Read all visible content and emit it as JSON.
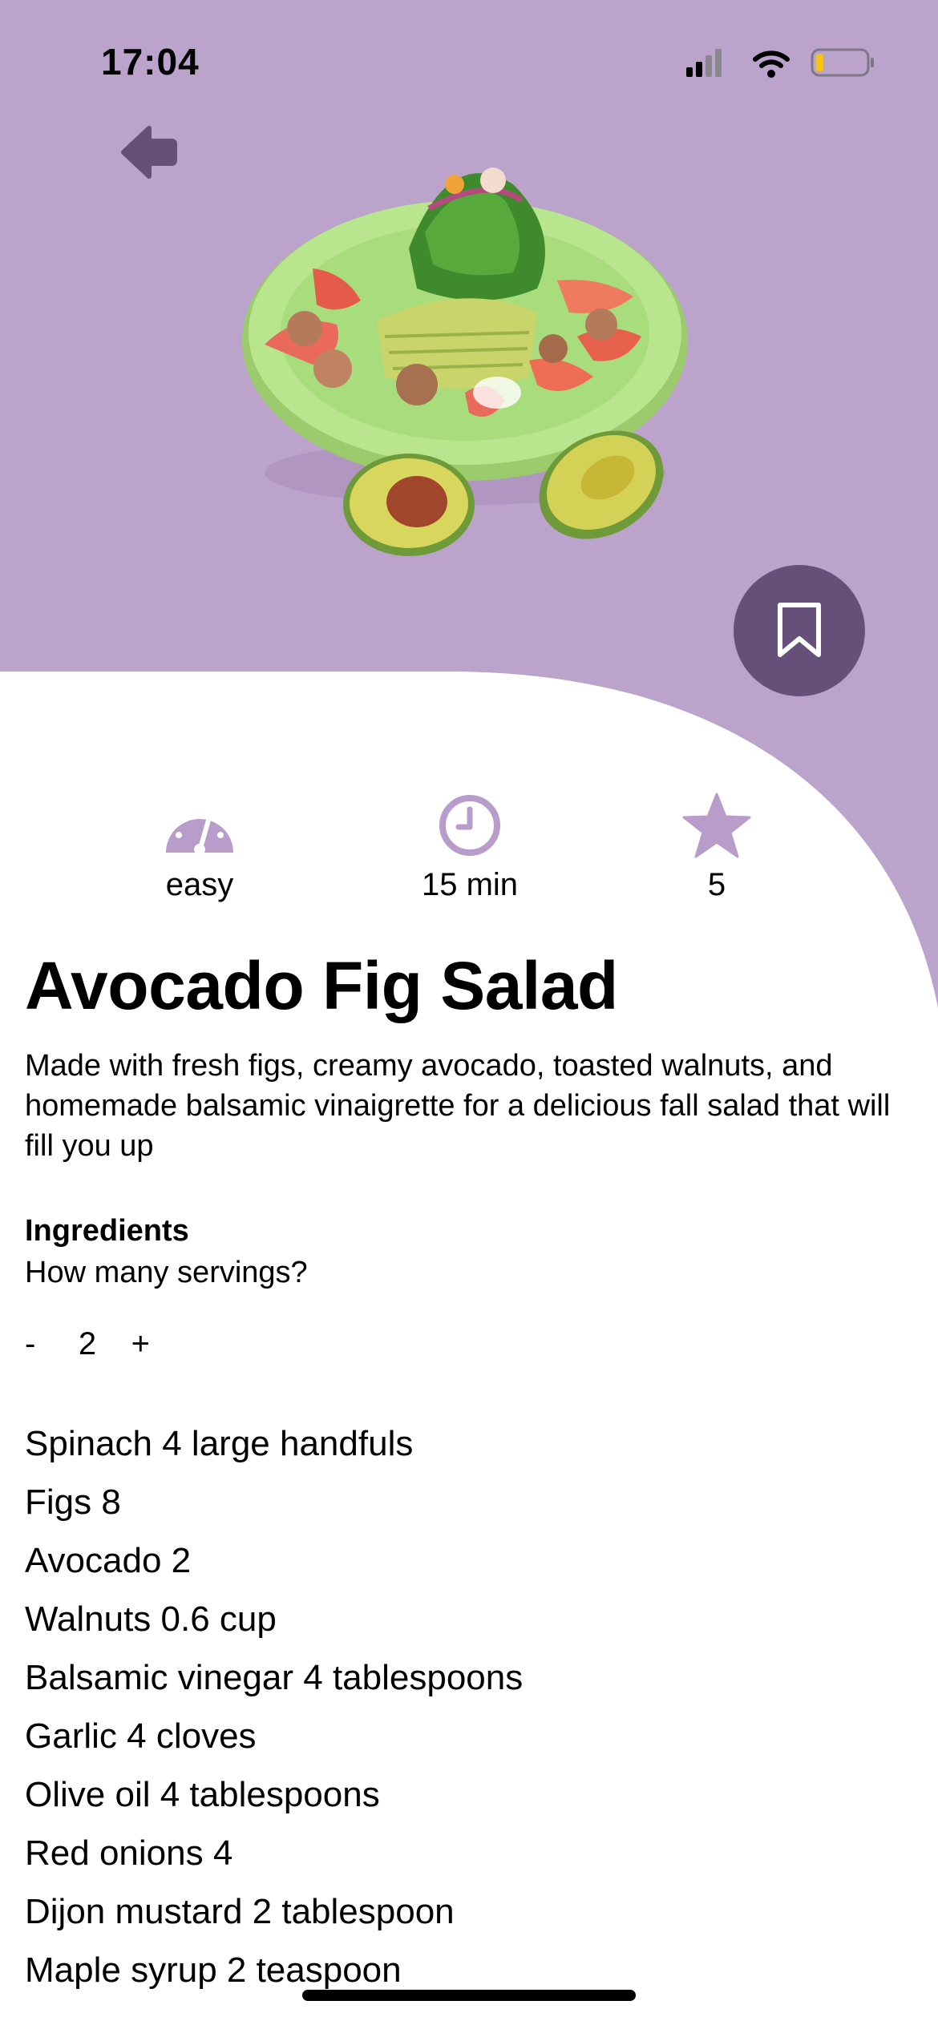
{
  "status_bar": {
    "time": "17:04",
    "battery_level": 0.15
  },
  "colors": {
    "hero": "#bba3cb",
    "accent": "#66507a",
    "icon": "#b89cc9"
  },
  "recipe": {
    "difficulty": "easy",
    "time": "15 min",
    "rating": "5",
    "title": "Avocado Fig Salad",
    "description": "Made with fresh figs, creamy avocado, toasted walnuts, and homemade balsamic vinaigrette for a delicious fall salad that will fill you up",
    "ingredients_heading": "Ingredients",
    "servings_prompt": "How many servings?",
    "servings": {
      "decrement_label": "-",
      "count": "2",
      "increment_label": "+"
    },
    "ingredients": [
      "Spinach 4 large handfuls",
      "Figs 8",
      "Avocado 2",
      "Walnuts 0.6 cup",
      "Balsamic vinegar 4 tablespoons",
      "Garlic 4 cloves",
      "Olive oil 4 tablespoons",
      "Red onions 4",
      "Dijon mustard 2 tablespoon",
      "Maple syrup 2 teaspoon"
    ]
  },
  "icons": {
    "back": "arrow-left-icon",
    "bookmark": "bookmark-icon",
    "difficulty": "gauge-icon",
    "time": "clock-icon",
    "rating": "star-icon"
  }
}
